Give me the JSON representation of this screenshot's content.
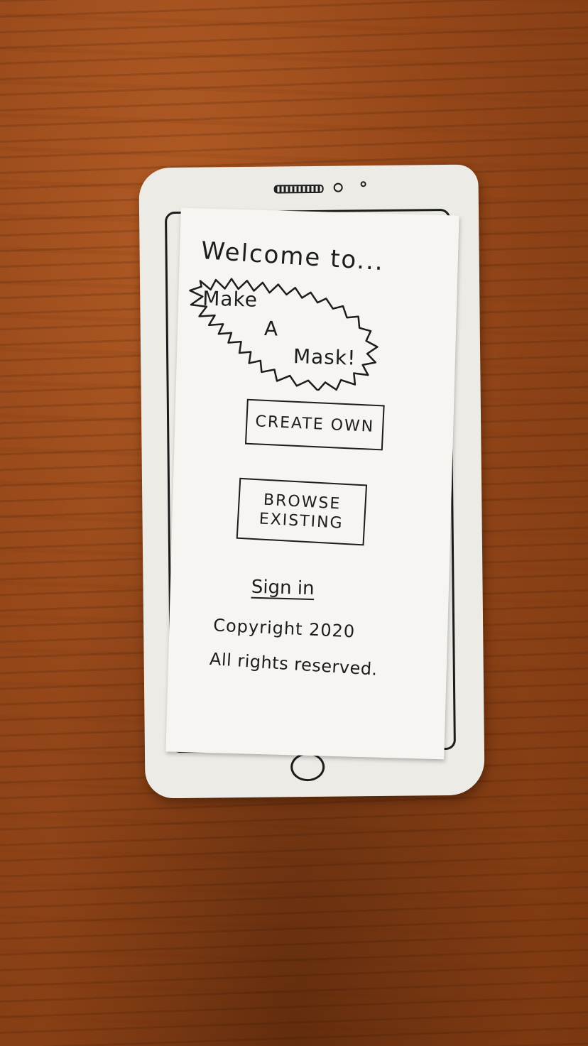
{
  "screen": {
    "welcome_text": "Welcome to...",
    "logo_lines": [
      "Make",
      "A",
      "Mask!"
    ],
    "create_button_label": "CREATE OWN",
    "browse_button_label_line1": "BROWSE",
    "browse_button_label_line2": "EXISTING",
    "signin_label": "Sign in",
    "copyright_text": "Copyright 2020",
    "rights_text": "All rights reserved."
  },
  "colors": {
    "ink": "#1d1d1d",
    "paper": "#f6f5f1",
    "table_wood": "#954719"
  }
}
